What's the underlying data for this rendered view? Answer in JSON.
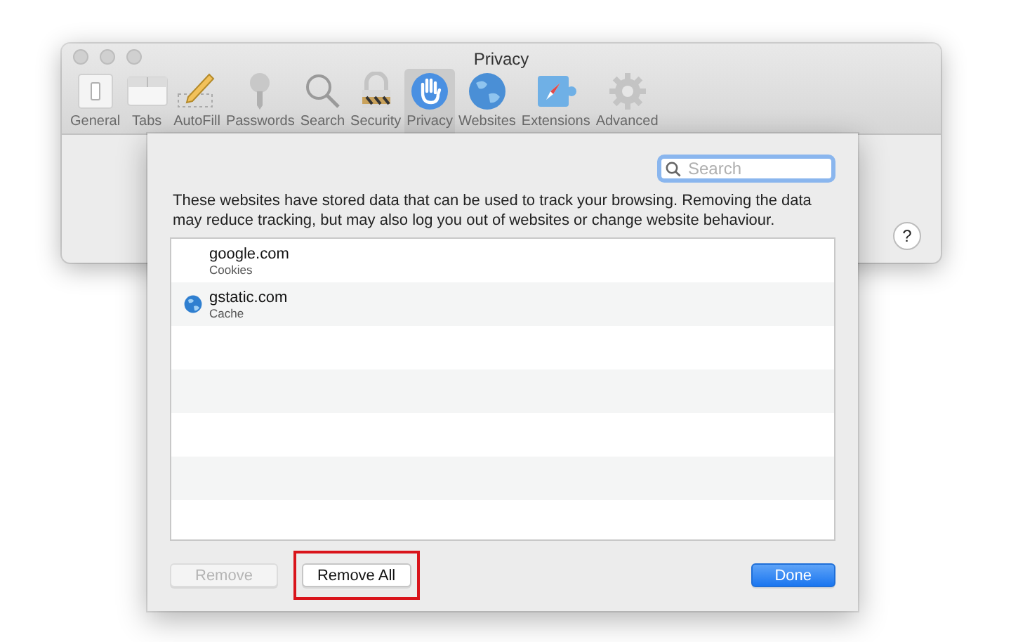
{
  "window": {
    "title": "Privacy",
    "help": "?"
  },
  "toolbar": [
    {
      "label": "General",
      "selected": false
    },
    {
      "label": "Tabs",
      "selected": false
    },
    {
      "label": "AutoFill",
      "selected": false
    },
    {
      "label": "Passwords",
      "selected": false
    },
    {
      "label": "Search",
      "selected": false
    },
    {
      "label": "Security",
      "selected": false
    },
    {
      "label": "Privacy",
      "selected": true
    },
    {
      "label": "Websites",
      "selected": false
    },
    {
      "label": "Extensions",
      "selected": false
    },
    {
      "label": "Advanced",
      "selected": false
    }
  ],
  "sheet": {
    "search": {
      "placeholder": "Search"
    },
    "description": "These websites have stored data that can be used to track your browsing. Removing the data may reduce tracking, but may also log you out of websites or change website behaviour.",
    "sites": [
      {
        "name": "google.com",
        "detail": "Cookies",
        "icon": false
      },
      {
        "name": "gstatic.com",
        "detail": "Cache",
        "icon": true
      }
    ],
    "buttons": [
      {
        "label": "Remove",
        "kind": "plain",
        "disabled": true,
        "highlighted": false
      },
      {
        "label": "Remove All",
        "kind": "plain",
        "disabled": false,
        "highlighted": true
      },
      {
        "label": "Done",
        "kind": "default",
        "disabled": false,
        "highlighted": false
      }
    ]
  }
}
